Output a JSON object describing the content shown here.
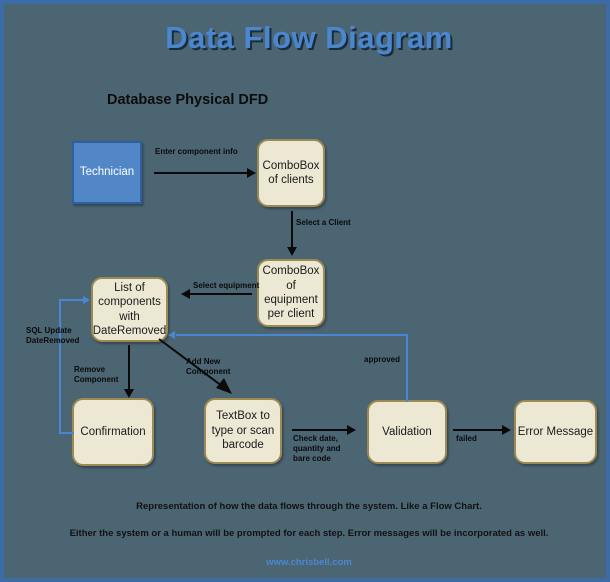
{
  "header": {
    "title": "Data Flow Diagram",
    "subtitle": "Database Physical DFD",
    "title_color": "#4a87d0",
    "background_color": "#4b6573",
    "border_color": "#3d6ba5"
  },
  "nodes": [
    {
      "id": "technician",
      "label": "Technician",
      "type": "actor",
      "fill": "#5187c7",
      "border": "#2f5f9e",
      "text_color": "#ffffff"
    },
    {
      "id": "combo_clients",
      "label": "ComboBox\nof clients",
      "type": "process",
      "fill": "#ece8d4",
      "border": "#9b8a52",
      "text_color": "#1b1b1b"
    },
    {
      "id": "combo_equipment",
      "label": "ComboBox\nof\nequipment\nper client",
      "type": "process",
      "fill": "#ece8d4",
      "border": "#9b8a52",
      "text_color": "#1b1b1b"
    },
    {
      "id": "list_components",
      "label": "List of\ncomponents\nwith\nDateRemoved",
      "type": "process",
      "fill": "#ece8d4",
      "border": "#9b8a52",
      "text_color": "#1b1b1b"
    },
    {
      "id": "confirmation",
      "label": "Confirmation",
      "type": "process",
      "fill": "#ece8d4",
      "border": "#9b8a52",
      "text_color": "#1b1b1b"
    },
    {
      "id": "textbox",
      "label": "TextBox to\ntype or scan\nbarcode",
      "type": "process",
      "fill": "#ece8d4",
      "border": "#9b8a52",
      "text_color": "#1b1b1b"
    },
    {
      "id": "validation",
      "label": "Validation",
      "type": "process",
      "fill": "#ece8d4",
      "border": "#9b8a52",
      "text_color": "#1b1b1b"
    },
    {
      "id": "error_message",
      "label": "Error Message",
      "type": "process",
      "fill": "#ece8d4",
      "border": "#9b8a52",
      "text_color": "#1b1b1b"
    }
  ],
  "edges": [
    {
      "id": "e1",
      "from": "technician",
      "to": "combo_clients",
      "label": "Enter component info",
      "color": "#0a0a0a"
    },
    {
      "id": "e2",
      "from": "combo_clients",
      "to": "combo_equipment",
      "label": "Select a Client",
      "color": "#0a0a0a"
    },
    {
      "id": "e3",
      "from": "combo_equipment",
      "to": "list_components",
      "label": "Select equipment",
      "color": "#0a0a0a"
    },
    {
      "id": "e4",
      "from": "list_components",
      "to": "confirmation",
      "label": "Remove\nComponent",
      "color": "#0a0a0a"
    },
    {
      "id": "e5",
      "from": "confirmation",
      "to": "list_components",
      "label": "SQL Update\nDateRemoved",
      "color": "#4a87d0"
    },
    {
      "id": "e6",
      "from": "list_components",
      "to": "textbox",
      "label": "Add New\nComponent",
      "color": "#0a0a0a"
    },
    {
      "id": "e7",
      "from": "textbox",
      "to": "validation",
      "label": "Check date,\nquantity and\nbare code",
      "color": "#0a0a0a"
    },
    {
      "id": "e8",
      "from": "validation",
      "to": "list_components",
      "label": "approved",
      "color": "#4a87d0"
    },
    {
      "id": "e9",
      "from": "validation",
      "to": "error_message",
      "label": "failed",
      "color": "#0a0a0a"
    }
  ],
  "footer": {
    "line1": "Representation of how the data flows through the system. Like a Flow Chart.",
    "line2": "Either the system or a human will be prompted for each step. Error messages will be incorporated as well.",
    "url": "www.chrisbell.com"
  }
}
